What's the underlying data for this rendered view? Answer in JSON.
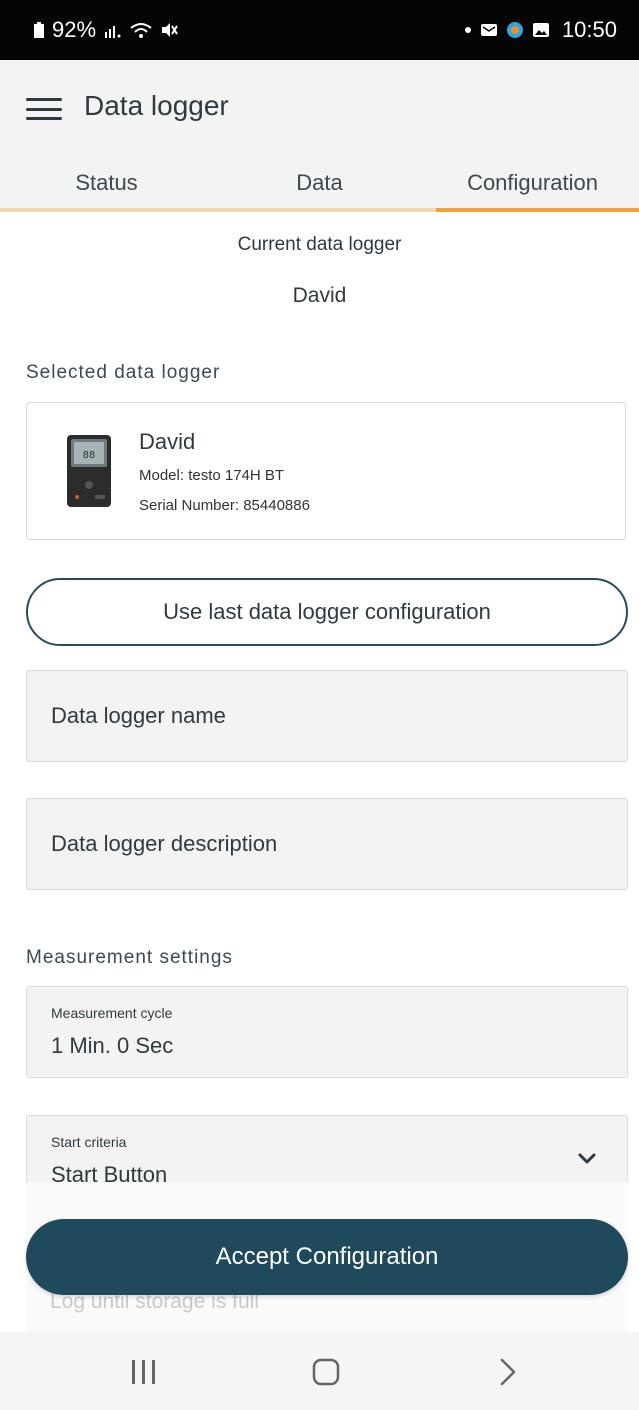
{
  "status_bar": {
    "battery": "92%",
    "time": "10:50",
    "icons_left": [
      "battery-icon",
      "signal-icon",
      "wifi-icon",
      "mute-icon"
    ],
    "icons_right": [
      "dot-icon",
      "message-icon",
      "browser-icon",
      "gallery-icon"
    ]
  },
  "app_bar": {
    "title": "Data logger",
    "menu_icon": "hamburger-menu-icon"
  },
  "tabs": [
    {
      "label": "Status",
      "active": false
    },
    {
      "label": "Data",
      "active": false
    },
    {
      "label": "Configuration",
      "active": true
    }
  ],
  "colors": {
    "tab_active": "#f3a23a",
    "primary_button": "#1f4a5c",
    "app_bar_bg": "#f3f3f3"
  },
  "current_logger": {
    "label": "Current data logger",
    "name": "David"
  },
  "selected_section_label": "Selected data logger",
  "selected_logger": {
    "name": "David",
    "model": "Model:  testo 174H BT",
    "serial": "Serial Number: 85440886"
  },
  "use_last_button": "Use last data logger configuration",
  "name_field": {
    "placeholder": "Data logger name"
  },
  "description_field": {
    "placeholder": "Data logger description"
  },
  "measurement_section_label": "Measurement settings",
  "measurement_cycle": {
    "label": "Measurement cycle",
    "value": "1 Min. 0 Sec"
  },
  "start_criteria": {
    "label": "Start criteria",
    "value": "Start Button"
  },
  "log_option_faded": "Log until storage is full",
  "accept_button": "Accept Configuration",
  "nav_bar": [
    "recents-icon",
    "home-icon",
    "back-icon"
  ]
}
